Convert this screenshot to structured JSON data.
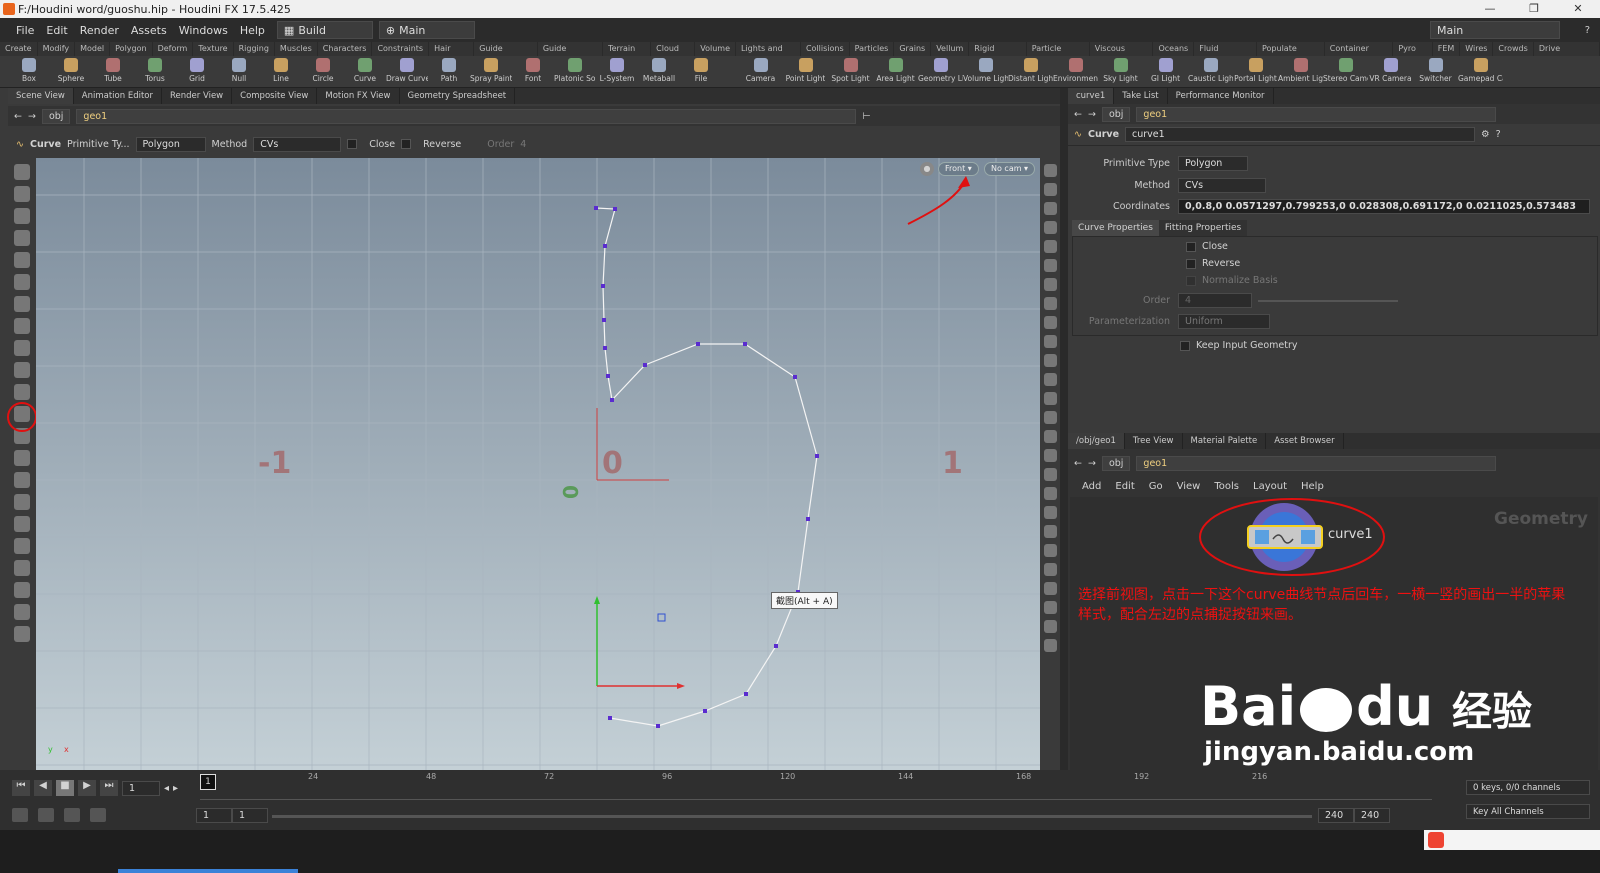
{
  "window": {
    "title": "F:/Houdini word/guoshu.hip - Houdini FX 17.5.425"
  },
  "menu": [
    "File",
    "Edit",
    "Render",
    "Assets",
    "Windows",
    "Help"
  ],
  "desktop": {
    "build_label": "Build",
    "main_label": "Main",
    "main_right": "Main"
  },
  "shelf_tabs_left": [
    "Create",
    "Modify",
    "Model",
    "Polygon",
    "Deform",
    "Texture",
    "Rigging",
    "Muscles",
    "Characters",
    "Constraints",
    "Hair Utils",
    "Guide Process",
    "Guide Brushes",
    "Terrain FX",
    "Cloud FX",
    "Volume"
  ],
  "shelf_tabs_right": [
    "Lights and C...",
    "Collisions",
    "Particles",
    "Grains",
    "Vellum",
    "Rigid Bodies",
    "Particle Fluids",
    "Viscous Fluids",
    "Oceans",
    "Fluid Contai...",
    "Populate Con...",
    "Container Tools",
    "Pyro FX",
    "FEM",
    "Wires",
    "Crowds",
    "Drive Simula..."
  ],
  "tools_left": [
    "Box",
    "Sphere",
    "Tube",
    "Torus",
    "Grid",
    "Null",
    "Line",
    "Circle",
    "Curve",
    "Draw Curve",
    "Path",
    "Spray Paint",
    "Font",
    "Platonic Solids",
    "L-System",
    "Metaball",
    "File"
  ],
  "tools_right": [
    "Camera",
    "Point Light",
    "Spot Light",
    "Area Light",
    "Geometry Light",
    "Volume Light",
    "Distant Light",
    "Environment Light",
    "Sky Light",
    "GI Light",
    "Caustic Light",
    "Portal Light",
    "Ambient Light",
    "Stereo Camera",
    "VR Camera",
    "Switcher",
    "Gamepad Camera"
  ],
  "pane_tabs_left": [
    "Scene View",
    "Animation Editor",
    "Render View",
    "Composite View",
    "Motion FX View",
    "Geometry Spreadsheet"
  ],
  "pane_tabs_right": [
    "curve1",
    "Take List",
    "Performance Monitor"
  ],
  "path": {
    "obj": "obj",
    "geo": "geo1"
  },
  "tool_options": {
    "tool": "Curve",
    "primitive_type_label": "Primitive Ty...",
    "primitive_type": "Polygon",
    "method_label": "Method",
    "method": "CVs",
    "close_label": "Close",
    "reverse_label": "Reverse",
    "order_label": "Order",
    "order": "4"
  },
  "viewport": {
    "view_label": "Front",
    "cam_label": "No cam",
    "grid_labels": [
      "-1",
      "0",
      "1"
    ],
    "tooltip": "截图(Alt + A)"
  },
  "params": {
    "node_type": "Curve",
    "node_name": "curve1",
    "primitive_type_label": "Primitive Type",
    "primitive_type": "Polygon",
    "method_label": "Method",
    "method": "CVs",
    "coordinates_label": "Coordinates",
    "coordinates": "0,0.8,0 0.0571297,0.799253,0 0.028308,0.691172,0 0.0211025,0.573483",
    "tabs": [
      "Curve Properties",
      "Fitting Properties"
    ],
    "close": "Close",
    "reverse": "Reverse",
    "normalize": "Normalize Basis",
    "order_label": "Order",
    "order": "4",
    "param_label": "Parameterization",
    "param": "Uniform",
    "keep_input": "Keep Input Geometry"
  },
  "network": {
    "tabs": [
      "/obj/geo1",
      "Tree View",
      "Material Palette",
      "Asset Browser"
    ],
    "menu": [
      "Add",
      "Edit",
      "Go",
      "View",
      "Tools",
      "Layout",
      "Help"
    ],
    "context": "Geometry",
    "node": "curve1",
    "annotation": "选择前视图，点击一下这个curve曲线节点后回车，一横一竖的画出一半的苹果样式，配合左边的点捕捉按钮来画。"
  },
  "timeline": {
    "frame": "1",
    "current_marker": "1",
    "ticks": [
      "24",
      "48",
      "72",
      "96",
      "120",
      "144",
      "168",
      "192",
      "216"
    ],
    "start": "1",
    "start2": "1",
    "end": "240",
    "end2": "240",
    "keys": "0 keys, 0/0 channels",
    "key_all": "Key All Channels"
  },
  "watermark": {
    "brand": "Bai",
    "brand2": "du",
    "cn": "经验",
    "url": "jingyan.baidu.com"
  },
  "colors": {
    "curve_point": "#5a2ccf",
    "annotation": "#e01010",
    "x_axis": "#e03030",
    "y_axis": "#30c030"
  }
}
